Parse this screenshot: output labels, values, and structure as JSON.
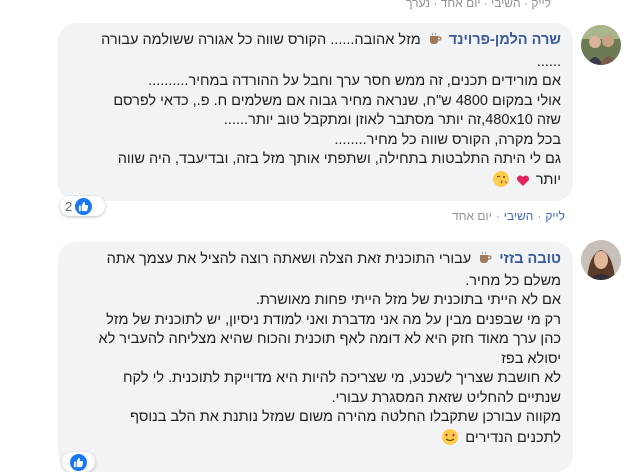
{
  "top_strip": {
    "text": "לייק · השיבי · יום אחד · נערך"
  },
  "comments": [
    {
      "author": "שרה הלמן-פרוינד",
      "lines": [
        "מזל אהובה...... הקורס שווה כל אגורה ששולמה עבורה",
        "......",
        "אם מורידים תכנים, זה ממש חסר ערך וחבל על ההורדה במחיר..........",
        "אולי במקום 4800 ש\"ח, שנראה מחיר גבוה אם משלמים ח. פ., כדאי לפרסם",
        "שזה 480x10,זה יותר מסתבר לאוזן ומתקבל טוב יותר......",
        "בכל מקרה, הקורס שווה כל מחיר........",
        "גם לי היתה התלבטות בתחילה, ושתפתי אותך מזל בזה, ובדיעבד, היה שווה",
        "יותר"
      ],
      "reaction_count": "2",
      "actions": {
        "like": "לייק",
        "reply": "השיבי",
        "time": "יום אחד"
      }
    },
    {
      "author": "טובה בזזי",
      "lines": [
        "עבורי התוכנית זאת הצלה ושאתה רוצה להציל את עצמך אתה",
        "משלם כל מחיר.",
        "אם לא הייתי בתוכנית של מזל הייתי פחות מאושרת.",
        "רק מי שבפנים מבין על מה אני מדברת ואני למודת ניסיון, יש לתוכנית של מזל",
        "כהן ערך מאוד חזק היא לא דומה לאף תוכנית והכוח שהיא מצליחה להעביר לא",
        "יסולא בפז",
        "לא חושבת שצריך לשכנע, מי שצריכה להיות היא מדוייקת לתוכנית. לי לקח",
        "שנתיים להחליט שזאת המסגרת עבורי.",
        "מקווה עבורכן שתקבלו החלטה מהירה משום שמזל נותנת את הלב בנוסף",
        "לתכנים הנדירים"
      ]
    }
  ],
  "colors": {
    "name": "#385898",
    "action": "#4267b2",
    "bubble": "#f2f3f5",
    "like": "#1877f2"
  },
  "icons": [
    "coffee-icon",
    "kiss-emoji-icon",
    "heart-icon",
    "love-face-emoji-icon",
    "thumbs-up-icon"
  ]
}
